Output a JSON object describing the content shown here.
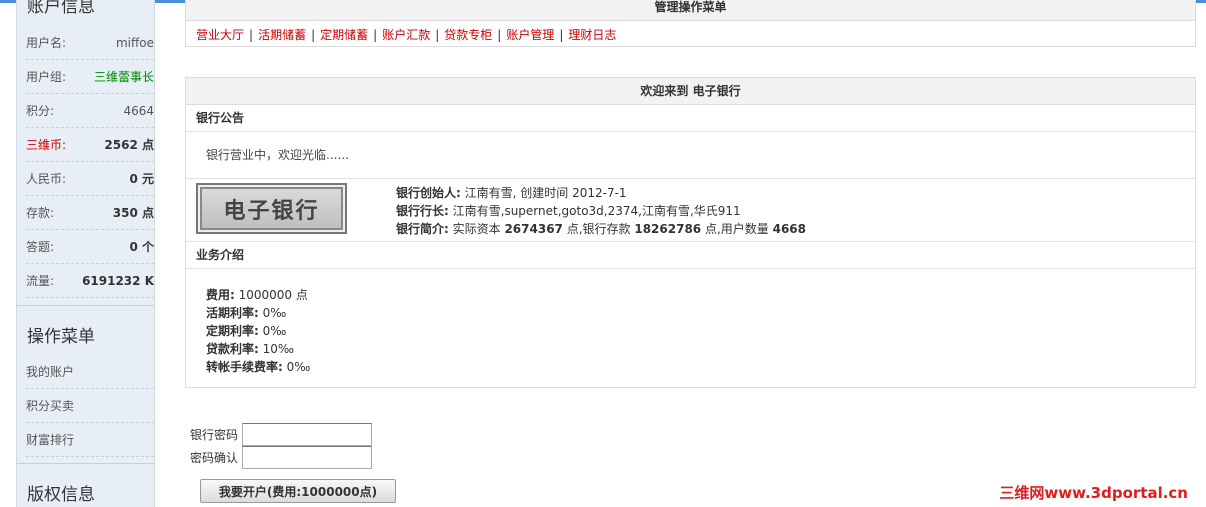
{
  "sidebar": {
    "account_title": "账户信息",
    "info": [
      {
        "label": "用户名:",
        "value": "miffoe"
      },
      {
        "label": "用户组:",
        "value": "三维蕾事长"
      },
      {
        "label": "积分:",
        "value": "4664"
      },
      {
        "label": "三维币:",
        "value": "2562 点"
      },
      {
        "label": "人民币:",
        "value": "0 元"
      },
      {
        "label": "存款:",
        "value": "350 点"
      },
      {
        "label": "答题:",
        "value": "0 个"
      },
      {
        "label": "流量:",
        "value": "6191232 K"
      }
    ],
    "ops_title": "操作菜单",
    "ops": [
      "我的账户",
      "积分买卖",
      "财富排行"
    ],
    "copyright_title": "版权信息"
  },
  "menu_panel": {
    "title": "管理操作菜单",
    "links": [
      "营业大厅",
      "活期储蓄",
      "定期储蓄",
      "账户汇款",
      "贷款专柜",
      "账户管理",
      "理财日志"
    ]
  },
  "bank": {
    "welcome": "欢迎来到 电子银行",
    "notice_title": "银行公告",
    "notice_text": "银行营业中，欢迎光临......",
    "logo_text": "电子银行",
    "founder_label": "银行创始人:",
    "founder_value": " 江南有雪, 创建时间 2012-7-1",
    "president_label": "银行行长:",
    "president_value": " 江南有雪,supernet,goto3d,2374,江南有雪,华氏911",
    "intro_label": "银行简介:",
    "intro_prefix": " 实际资本 ",
    "capital": "2674367",
    "intro_mid": " 点,银行存款 ",
    "deposits": "18262786",
    "intro_mid2": " 点,用户数量 ",
    "users": "4668",
    "biz_title": "业务介绍",
    "biz": [
      {
        "label": "费用:",
        "value": " 1000000 点"
      },
      {
        "label": "活期利率:",
        "value": " 0‰"
      },
      {
        "label": "定期利率:",
        "value": " 0‰"
      },
      {
        "label": "贷款利率:",
        "value": " 10‰"
      },
      {
        "label": "转帐手续费率:",
        "value": " 0‰"
      }
    ]
  },
  "form": {
    "password_label": "银行密码",
    "confirm_label": "密码确认",
    "submit_label": "我要开户(费用:1000000点)"
  },
  "watermark": "三维网www.3dportal.cn",
  "colors": {
    "accent_red": "#cc0000",
    "group_green": "#008800",
    "top_bar": "#4a90d9"
  }
}
